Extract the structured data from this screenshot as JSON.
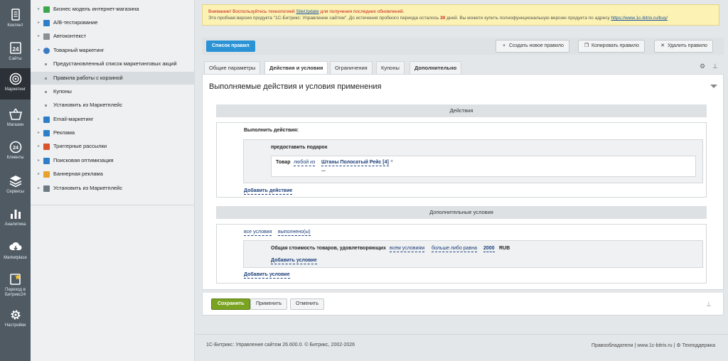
{
  "sidebar": {
    "items": [
      {
        "label": "Контент",
        "icon": "document-icon",
        "active": false
      },
      {
        "label": "Сайты",
        "icon": "calendar-24-icon",
        "active": false
      },
      {
        "label": "Маркетинг",
        "icon": "target-icon",
        "active": true
      },
      {
        "label": "Магазин",
        "icon": "basket-icon",
        "active": false
      },
      {
        "label": "Клиенты",
        "icon": "clients-24-icon",
        "active": false
      },
      {
        "label": "Сервисы",
        "icon": "layers-icon",
        "active": false
      },
      {
        "label": "Аналитика",
        "icon": "bar-chart-icon",
        "active": false
      },
      {
        "label": "Marketplace",
        "icon": "cloud-download-icon",
        "active": false
      },
      {
        "label": "Переход в Битрикс24",
        "icon": "bitrix24-star-icon",
        "active": false
      },
      {
        "label": "Настройки",
        "icon": "gear-icon",
        "active": false
      }
    ]
  },
  "tree": {
    "items": [
      {
        "label": "Бизнес модель интернет-магазина",
        "type": "folder",
        "icon_color": "#3aa84a"
      },
      {
        "label": "A/B-тестирование",
        "type": "folder",
        "icon_color": "#2c7ec8"
      },
      {
        "label": "Автоконтекст",
        "type": "folder",
        "icon_color": "#8a8f93"
      },
      {
        "label": "Товарный маркетинг",
        "type": "folder-open",
        "icon_color": "#3b79c4"
      },
      {
        "label": "Предустановленный список маркетинговых акций",
        "type": "leaf"
      },
      {
        "label": "Правила работы с корзиной",
        "type": "leaf",
        "selected": true
      },
      {
        "label": "Купоны",
        "type": "leaf"
      },
      {
        "label": "Установить из Маркетплейс",
        "type": "leaf"
      },
      {
        "label": "Email-маркетинг",
        "type": "folder",
        "icon_color": "#2c7ec8"
      },
      {
        "label": "Реклама",
        "type": "folder",
        "icon_color": "#2c7ec8"
      },
      {
        "label": "Триггерные рассылки",
        "type": "folder",
        "icon_color": "#d9532c"
      },
      {
        "label": "Поисковая оптимизация",
        "type": "folder",
        "icon_color": "#2c7ec8"
      },
      {
        "label": "Баннерная реклама",
        "type": "folder",
        "icon_color": "#e8a12a"
      },
      {
        "label": "Установить из Маркетплейс",
        "type": "folder",
        "icon_color": "#6c7a84"
      }
    ]
  },
  "notice": {
    "warning": "Внимание! Воспользуйтесь технологией",
    "siteupdate_link": "SiteUpdate",
    "warning_tail": "для получения последних обновлений.",
    "text_before_days": "Это пробная версия продукта \"1С-Битрикс: Управление сайтом\". До истечения пробного периода осталось",
    "days": "30",
    "text_after_days": "дней. Вы можете купить полнофункциональную версию продукта по адресу",
    "buy_link": "https://www.1c-bitrix.ru/buy/"
  },
  "toolbar": {
    "back_label": "Список правил",
    "create_label": "Создать новое правило",
    "copy_label": "Копировать правило",
    "delete_label": "Удалить правило"
  },
  "tabs": [
    {
      "label": "Общие параметры",
      "active": false
    },
    {
      "label": "Действия и условия",
      "active": true
    },
    {
      "label": "Ограничения",
      "active": false
    },
    {
      "label": "Купоны",
      "active": false
    },
    {
      "label": "Дополнительно",
      "active": false
    }
  ],
  "panel": {
    "title": "Выполняемые действия и условия применения",
    "actions": {
      "header": "Действия",
      "perform_label": "Выполнить действия:",
      "gift_label": "предоставить подарок",
      "product_label": "Товар",
      "any_of": "любой из",
      "product_value": "Штаны Полосатый Рейс [4]",
      "remove_symbol": "×",
      "ellipsis": "...",
      "add_action": "Добавить действие"
    },
    "conditions": {
      "header": "Дополнительные условия",
      "all_conditions": "все условия",
      "fulfilled": "выполнено(ы)",
      "total_label": "Общая стоимость товаров, удовлетворяющих",
      "all_conditions_2": "всем условиям",
      "comparison": "больше либо равна",
      "amount": "2000",
      "currency": "RUB",
      "add_condition_inner": "Добавить условие",
      "add_condition": "Добавить условие"
    }
  },
  "buttons": {
    "save": "Сохранить",
    "apply": "Применить",
    "cancel": "Отменить"
  },
  "footer": {
    "copyright": "1С-Битрикс: Управление сайтом 26.600.0. © Битрикс, 2002-2026",
    "rights": "Правообладатели",
    "site": "www.1c-bitrix.ru",
    "support": "Техподдержка"
  }
}
